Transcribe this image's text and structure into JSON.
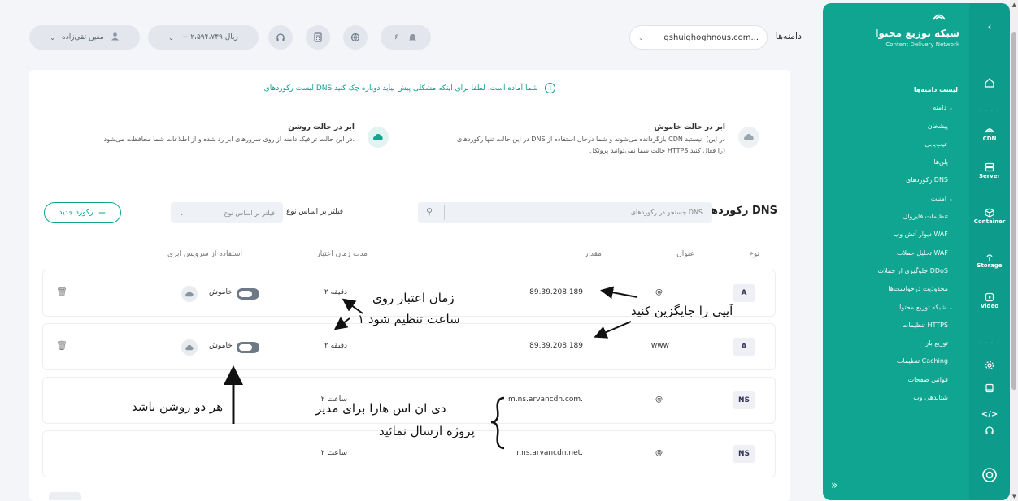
{
  "sidebar": {
    "brand_title": "شبکه توزیع محتوا",
    "brand_subtitle": "Content Delivery Network",
    "items": [
      {
        "label": "لیست دامنه‌ها"
      },
      {
        "label": "دامنه"
      },
      {
        "label": "پیشخان"
      },
      {
        "label": "عیب‌یابی"
      },
      {
        "label": "پلن‌ها"
      },
      {
        "label": "رکوردهای DNS"
      },
      {
        "label": "امنیت"
      },
      {
        "label": "تنظیمات فایروال"
      },
      {
        "label": "دیوار آتش وب WAF"
      },
      {
        "label": "تحلیل حملات WAF"
      },
      {
        "label": "جلوگیری از حملات DDoS"
      },
      {
        "label": "محدودیت درخواست‌ها"
      },
      {
        "label": "شبکه توزیع محتوا"
      },
      {
        "label": "تنظیمات HTTPS"
      },
      {
        "label": "توزیع بار"
      },
      {
        "label": "تنظیمات Caching"
      },
      {
        "label": "قوانین صفحات"
      },
      {
        "label": "شتابدهی وب"
      }
    ]
  },
  "rail": {
    "cdn": "CDN",
    "server": "Server",
    "container": "Container",
    "storage": "Storage",
    "video": "Video"
  },
  "topbar": {
    "user_name": "معین تقی‌زاده",
    "balance": "+ ۲،۵۹۴،۷۴۹ ریال",
    "notif_count": "۶",
    "domain_label": "دامنه‌ها",
    "domain_value": "gshuighoghnous.com..."
  },
  "main": {
    "info_message": "لیست رکوردهای DNS شما آماده است. لطفا برای اینکه مشکلی پیش نیاید دوباره چک کنید",
    "mode_off_title": "ابر در حالت خاموش",
    "mode_off_desc": "در این حالت تنها رکوردهای DNS بازگردانده می‌شوند و شما درحال استفاده از CDN نیستید. (در این حالت شما نمی‌توانید پروتکل HTTPS را فعال کنید)",
    "mode_on_title": "ابر در حالت روشن",
    "mode_on_desc": "در این حالت ترافیک دامنه از روی سرورهای ابر رد شده و از اطلاعات شما محافظت می‌شود.",
    "dns_title": "رکوردهای DNS",
    "search_placeholder": "جستجو در رکوردهای DNS",
    "filter_label": "فیلتر بر اساس نوع",
    "filter_placeholder": "فیلتر بر اساس نوع",
    "add_button": "رکورد جدید"
  },
  "table": {
    "headers": {
      "type": "نوع",
      "name": "عنوان",
      "value": "مقدار",
      "ttl": "مدت زمان اعتبار",
      "cloud": "استفاده از سرویس ابری"
    },
    "rows": [
      {
        "type": "A",
        "name": "@",
        "value": "89.39.208.189",
        "ttl": "۲ دقیقه",
        "cloud": "خاموش"
      },
      {
        "type": "A",
        "name": "www",
        "value": "89.39.208.189",
        "ttl": "۲ دقیقه",
        "cloud": "خاموش"
      },
      {
        "type": "NS",
        "name": "@",
        "value": "m.ns.arvancdn.com.",
        "ttl": "۲ ساعت",
        "cloud": ""
      },
      {
        "type": "NS",
        "name": "@",
        "value": "r.ns.arvancdn.net.",
        "ttl": "۲ ساعت",
        "cloud": ""
      }
    ]
  },
  "annotations": {
    "ttl_note_1": "زمان اعتبار روی",
    "ttl_note_2": "۱ ساعت تنظیم شود",
    "ip_note": "آیپی را جایگزین کنید",
    "cloud_note": "هر دو روشن باشد",
    "ns_note_1": "دی ان اس هارا برای مدیر",
    "ns_note_2": "پروژه ارسال نمائید"
  }
}
